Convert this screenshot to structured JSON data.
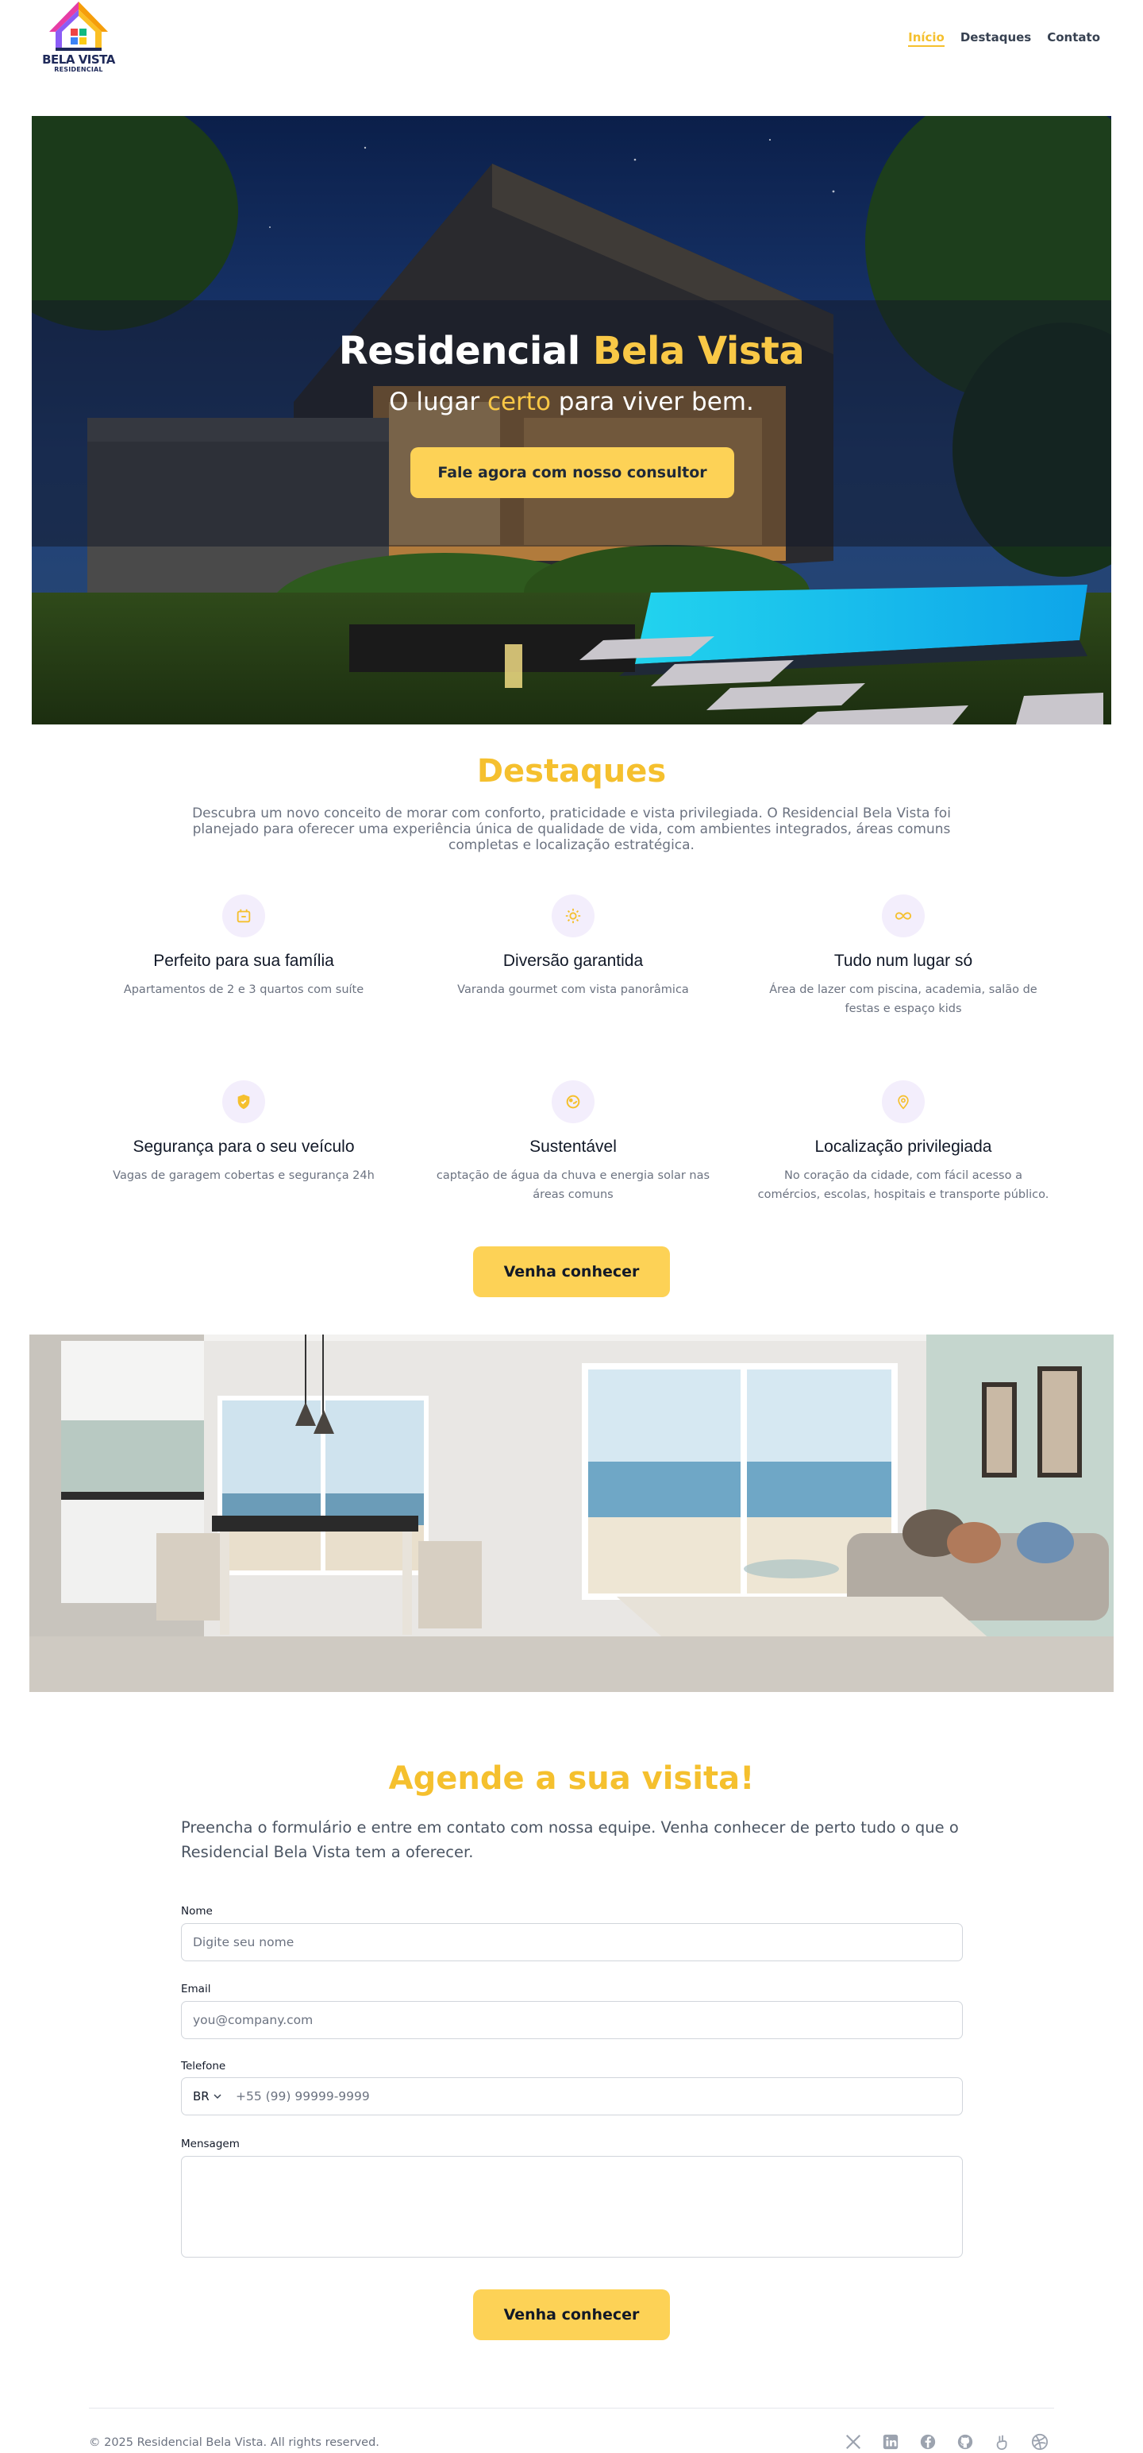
{
  "brand": {
    "logo_line1": "BELA VISTA",
    "logo_line2": "RESIDENCIAL",
    "colors": {
      "accent": "#f5c02e",
      "button": "#fdd256",
      "icon_bg": "#f3eefc"
    }
  },
  "nav": {
    "items": [
      {
        "label": "Início",
        "active": true
      },
      {
        "label": "Destaques",
        "active": false
      },
      {
        "label": "Contato",
        "active": false
      }
    ]
  },
  "hero": {
    "title_main": "Residencial",
    "title_accent": "Bela Vista",
    "subtitle_pre": "O lugar",
    "subtitle_accent": "certo",
    "subtitle_post": "para viver bem.",
    "button": "Fale agora com nosso consultor"
  },
  "destaques": {
    "title": "Destaques",
    "intro": "Descubra um novo conceito de morar com conforto, praticidade e vista privilegiada. O Residencial Bela Vista foi planejado para oferecer uma experiência única de qualidade de vida, com ambientes integrados, áreas comuns completas e localização estratégica.",
    "features": [
      {
        "icon": "house-icon",
        "title": "Perfeito para sua família",
        "desc": "Apartamentos de 2 e 3 quartos com suíte"
      },
      {
        "icon": "sun-icon",
        "title": "Diversão garantida",
        "desc": "Varanda gourmet com vista panorâmica"
      },
      {
        "icon": "infinity-icon",
        "title": "Tudo num lugar só",
        "desc": "Área de lazer com piscina, academia, salão de festas e espaço kids"
      },
      {
        "icon": "shield-icon",
        "title": "Segurança para o seu veículo",
        "desc": "Vagas de garagem cobertas e segurança 24h"
      },
      {
        "icon": "eco-icon",
        "title": "Sustentável",
        "desc": "captação de água da chuva e energia solar nas áreas comuns"
      },
      {
        "icon": "location-pin-icon",
        "title": "Localização privilegiada",
        "desc": "No coração da cidade, com fácil acesso a comércios, escolas, hospitais e transporte público."
      }
    ],
    "button": "Venha conhecer"
  },
  "form": {
    "title": "Agende a sua visita!",
    "intro": "Preencha o formulário e entre em contato com nossa equipe. Venha conhecer de perto tudo o que o Residencial Bela Vista tem a oferecer.",
    "name_label": "Nome",
    "name_placeholder": "Digite seu nome",
    "email_label": "Email",
    "email_placeholder": "you@company.com",
    "phone_label": "Telefone",
    "phone_country": "BR",
    "phone_placeholder": "+55 (99) 99999-9999",
    "message_label": "Mensagem",
    "button": "Venha conhecer"
  },
  "footer": {
    "copyright": "© 2025 Residencial Bela Vista. All rights reserved.",
    "socials": [
      "x-icon",
      "linkedin-icon",
      "facebook-icon",
      "github-icon",
      "peace-hand-icon",
      "dribbble-icon"
    ]
  }
}
